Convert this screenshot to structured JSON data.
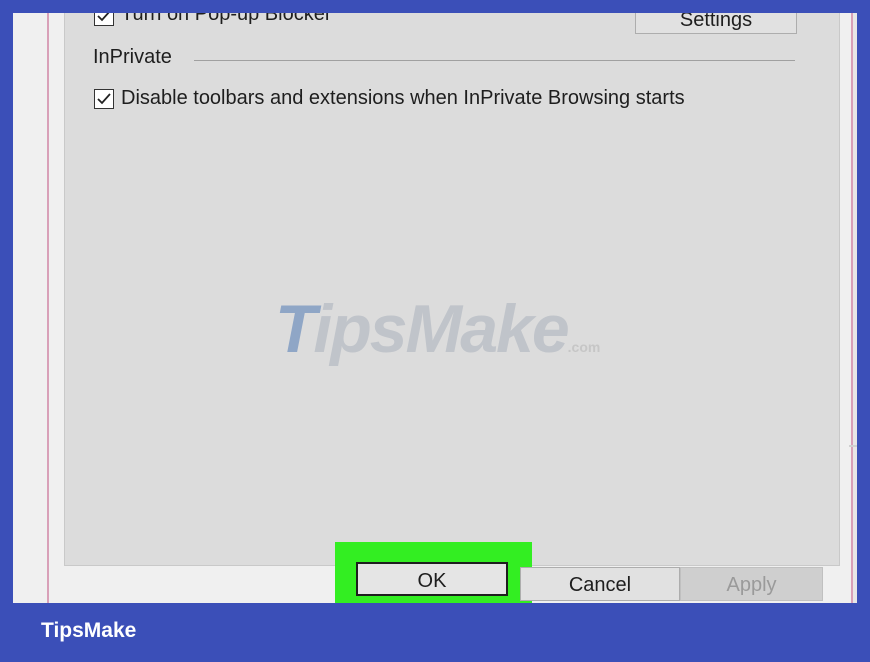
{
  "dialog": {
    "popup_blocker_label": "Turn on Pop-up Blocker",
    "settings_button": "Settings",
    "inprivate_heading": "InPrivate",
    "inprivate_checkbox_label": "Disable toolbars and extensions when InPrivate Browsing starts",
    "inprivate_checked": true,
    "popup_checked": true
  },
  "buttons": {
    "ok": "OK",
    "cancel": "Cancel",
    "apply": "Apply"
  },
  "watermark": {
    "t": "T",
    "rest": "ipsMake",
    "suffix": ".com"
  },
  "footer": {
    "brand": "TipsMake"
  },
  "colors": {
    "frame": "#3b4fb8",
    "highlight": "#33ee22"
  }
}
